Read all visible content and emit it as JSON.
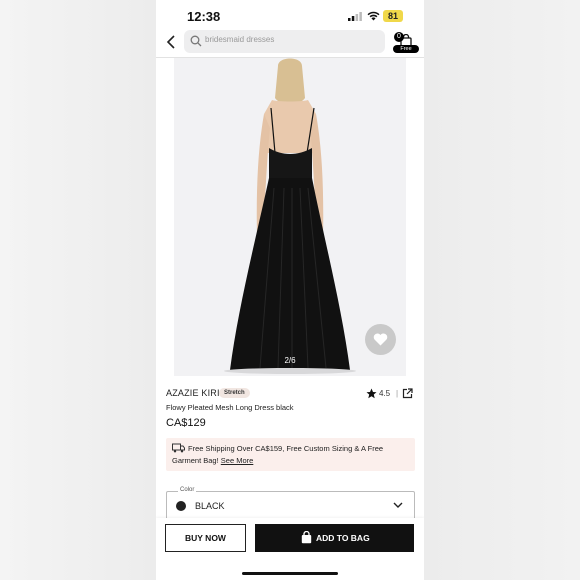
{
  "status_bar": {
    "time": "12:38",
    "battery": "81"
  },
  "header": {
    "search_placeholder": "bridesmaid dresses",
    "bag_count": "0",
    "bag_badge": "Free"
  },
  "gallery": {
    "pager": "2/6",
    "current_image": 2,
    "total_images": 6
  },
  "product": {
    "brand": "AZAZIE KIRI",
    "tag": "Stretch",
    "rating": "4.5",
    "name": "Flowy Pleated Mesh Long Dress black",
    "price": "CA$129"
  },
  "shipping": {
    "text": "Free Shipping Over CA$159, Free Custom Sizing & A Free Garment Bag!",
    "link": "See More"
  },
  "color": {
    "label": "Color",
    "value": "BLACK",
    "swatch": "#222222"
  },
  "actions": {
    "buy_now": "BUY NOW",
    "add_to_bag": "ADD TO BAG"
  },
  "colors": {
    "accent": "#111111",
    "shipping_bg": "#fbefec",
    "tag_bg": "#f1e6e1",
    "battery": "#f0d84a"
  }
}
